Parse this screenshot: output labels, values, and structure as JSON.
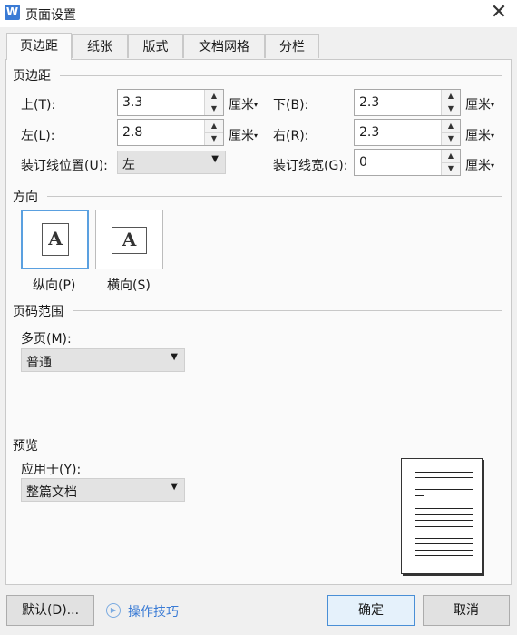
{
  "window": {
    "title": "页面设置",
    "app_icon_letter": "W"
  },
  "tabs": [
    "页边距",
    "纸张",
    "版式",
    "文档网格",
    "分栏"
  ],
  "margins": {
    "section": "页边距",
    "top": {
      "label": "上(T):",
      "value": "3.3",
      "unit": "厘米"
    },
    "bottom": {
      "label": "下(B):",
      "value": "2.3",
      "unit": "厘米"
    },
    "left": {
      "label": "左(L):",
      "value": "2.8",
      "unit": "厘米"
    },
    "right": {
      "label": "右(R):",
      "value": "2.3",
      "unit": "厘米"
    },
    "gutter_pos": {
      "label": "装订线位置(U):",
      "value": "左"
    },
    "gutter": {
      "label": "装订线宽(G):",
      "value": "0",
      "unit": "厘米"
    }
  },
  "orientation": {
    "section": "方向",
    "portrait": {
      "label": "纵向(P)",
      "glyph": "A"
    },
    "landscape": {
      "label": "横向(S)",
      "glyph": "A"
    }
  },
  "pages": {
    "section": "页码范围",
    "label": "多页(M):",
    "value": "普通"
  },
  "preview": {
    "section": "预览",
    "apply_label": "应用于(Y):",
    "apply_value": "整篇文档"
  },
  "buttons": {
    "default": "默认(D)...",
    "tips": "操作技巧",
    "ok": "确定",
    "cancel": "取消"
  },
  "colors": {
    "accent": "#3a7bd5",
    "selected_border": "#5aa0e0"
  }
}
